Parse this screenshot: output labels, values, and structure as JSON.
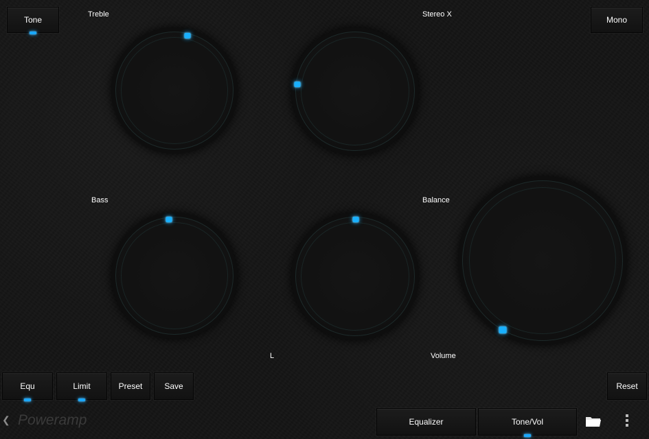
{
  "top_buttons": {
    "tone": "Tone",
    "mono": "Mono"
  },
  "knob_labels": {
    "treble": "Treble",
    "stereo_x": "Stereo X",
    "bass": "Bass",
    "balance": "Balance",
    "balance_left": "L",
    "volume": "Volume"
  },
  "bottom_buttons": {
    "equ": "Equ",
    "limit": "Limit",
    "preset": "Preset",
    "save": "Save",
    "reset": "Reset"
  },
  "footer": {
    "app_name": "Poweramp",
    "equalizer_tab": "Equalizer",
    "tone_vol_tab": "Tone/Vol"
  },
  "icons": {
    "back": "chevron-left-icon",
    "folder": "folder-icon",
    "menu": "more-vert-icon"
  },
  "colors": {
    "accent": "#1aa8ff",
    "background": "#141414"
  }
}
